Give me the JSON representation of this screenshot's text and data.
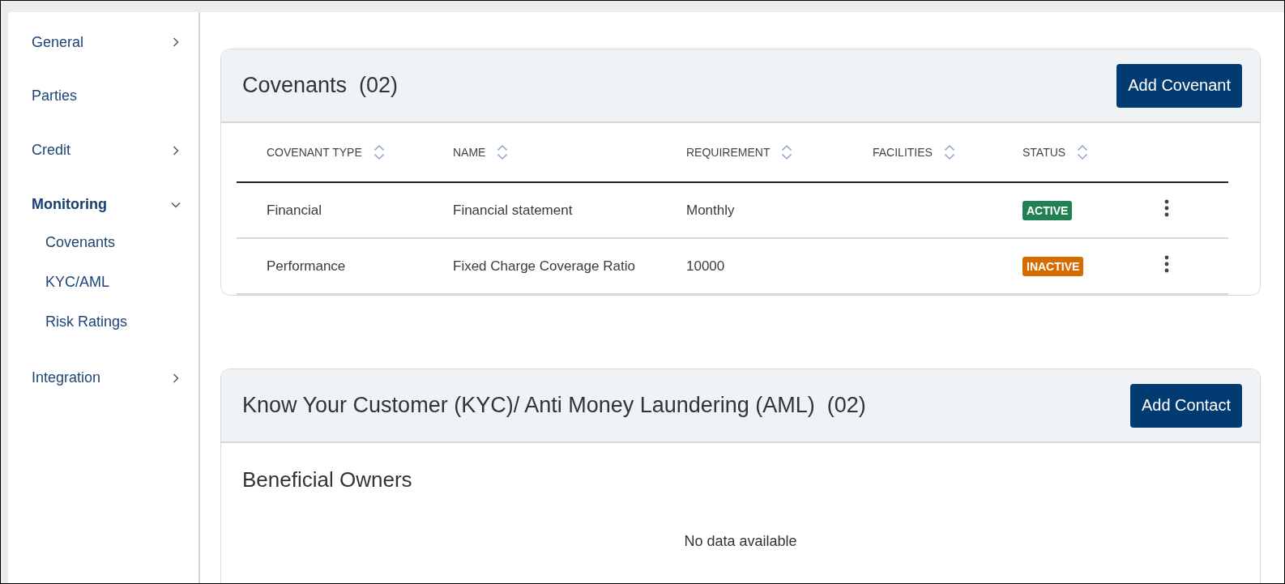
{
  "sidebar": {
    "items": [
      {
        "label": "General",
        "kind": "group",
        "expanded": false,
        "selected": false
      },
      {
        "label": "Parties",
        "kind": "link",
        "selected": false
      },
      {
        "label": "Credit",
        "kind": "group",
        "expanded": false,
        "selected": false
      },
      {
        "label": "Monitoring",
        "kind": "group",
        "expanded": true,
        "selected": true,
        "children": [
          {
            "label": "Covenants"
          },
          {
            "label": "KYC/AML"
          },
          {
            "label": "Risk Ratings"
          }
        ]
      },
      {
        "label": "Integration",
        "kind": "group",
        "expanded": false,
        "selected": false
      }
    ]
  },
  "covenants": {
    "title": "Covenants",
    "count": "(02)",
    "button": "Add Covenant",
    "columns": [
      "COVENANT TYPE",
      "NAME",
      "REQUIREMENT",
      "FACILITIES",
      "STATUS"
    ],
    "rows": [
      {
        "type": "Financial",
        "name": "Financial statement",
        "requirement": "Monthly",
        "status": "ACTIVE",
        "color": "#228152"
      },
      {
        "type": "Performance",
        "name": "Fixed Charge Coverage Ratio",
        "requirement": "10000",
        "status": "INACTIVE",
        "color": "#d86b00"
      }
    ]
  },
  "kyc": {
    "title": "Know Your Customer (KYC)/ Anti Money Laundering (AML)",
    "count": "(02)",
    "button": "Add Contact",
    "section": "Beneficial Owners",
    "empty": "No data available"
  }
}
